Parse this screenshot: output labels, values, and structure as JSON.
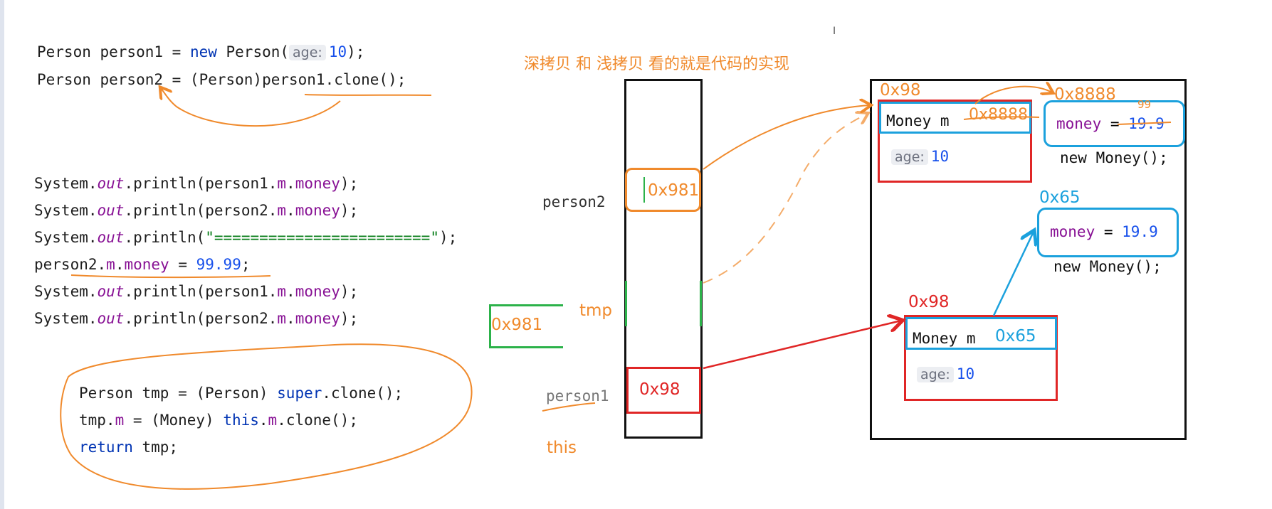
{
  "code": {
    "line1": {
      "p1": "Person person1 = ",
      "kw": "new",
      "p2": " Person(",
      "hint": "age:",
      "num": "10",
      "p3": ");"
    },
    "line2": {
      "text": "Person person2 = (Person)person1.clone();"
    },
    "print1": {
      "pre": "System.",
      "out": "out",
      "mid": ".println(person1.",
      "m": "m",
      "dot": ".",
      "money": "money",
      "end": ");"
    },
    "print2": {
      "pre": "System.",
      "out": "out",
      "mid": ".println(person2.",
      "m": "m",
      "dot": ".",
      "money": "money",
      "end": ");"
    },
    "print_sep": {
      "pre": "System.",
      "out": "out",
      "mid": ".println(",
      "str": "\"========================\"",
      "end": ");"
    },
    "assign": {
      "pre": "person2.",
      "m": "m",
      "dot": ".",
      "money": "money",
      "eq": " = ",
      "num": "99.99",
      "end": ";"
    },
    "print3": {
      "pre": "System.",
      "out": "out",
      "mid": ".println(person1.",
      "m": "m",
      "dot": ".",
      "money": "money",
      "end": ");"
    },
    "print4": {
      "pre": "System.",
      "out": "out",
      "mid": ".println(person2.",
      "m": "m",
      "dot": ".",
      "money": "money",
      "end": ");"
    },
    "clone1": {
      "p1": "Person tmp = (Person) ",
      "kw": "super",
      "p2": ".clone();"
    },
    "clone2": {
      "p1": "tmp.",
      "m1": "m",
      "p2": " = (Money) ",
      "kw": "this",
      "p3": ".",
      "m2": "m",
      "p4": ".clone();"
    },
    "clone3": {
      "kw": "return",
      "p1": " tmp;"
    }
  },
  "title": "深拷贝 和  浅拷贝 看的就是代码的实现",
  "stack": {
    "person2_label": "person2",
    "person2_addr": "0x981",
    "tmp_label": "tmp",
    "tmp_addr": "0x981",
    "person1_label": "person1",
    "person1_addr": "0x98",
    "this_label": "this"
  },
  "heap": {
    "obj_top": {
      "addr": "0x98",
      "money_field": "Money m",
      "money_ref": "0x8888",
      "hint": "age:",
      "age": "10"
    },
    "money_top": {
      "addr": "0x8888",
      "field": "money",
      "eq": " = ",
      "value": "19.9",
      "scribble": "99",
      "ctor": "new Money();"
    },
    "money_mid": {
      "addr": "0x65",
      "field": "money",
      "eq": " = ",
      "value": "19.9",
      "ctor": "new Money();"
    },
    "obj_bottom": {
      "addr": "0x98",
      "money_field": "Money m",
      "money_ref": "0x65",
      "hint": "age:",
      "age": "10"
    }
  },
  "cursor_glyph": "I",
  "colors": {
    "orange": "#f08a2c",
    "red": "#e02626",
    "blue": "#1ba1dd",
    "green": "#2cb24a"
  }
}
